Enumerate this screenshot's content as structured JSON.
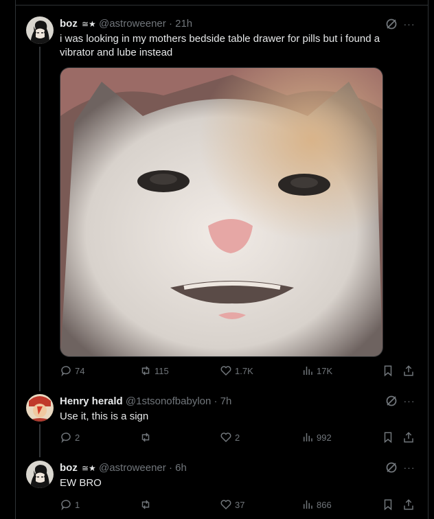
{
  "tweets": [
    {
      "name": "boz",
      "badge": "≅★",
      "handle": "@astroweener",
      "time": "21h",
      "text": "i was looking in my mothers bedside table drawer for pills but i found a vibrator and lube instead",
      "replies": "74",
      "retweets": "115",
      "likes": "1.7K",
      "views": "17K"
    },
    {
      "name": "Henry herald",
      "badge": "",
      "handle": "@1stsonofbabylon",
      "time": "7h",
      "text": "Use it, this is a sign",
      "replies": "2",
      "retweets": "",
      "likes": "2",
      "views": "992"
    },
    {
      "name": "boz",
      "badge": "≅★",
      "handle": "@astroweener",
      "time": "6h",
      "text": "EW BRO",
      "replies": "1",
      "retweets": "",
      "likes": "37",
      "views": "866"
    }
  ],
  "separator": "·",
  "more_glyph": "···",
  "colors": {
    "background": "#000000",
    "text": "#e7e9ea",
    "muted": "#71767b",
    "border": "#2f3336"
  }
}
